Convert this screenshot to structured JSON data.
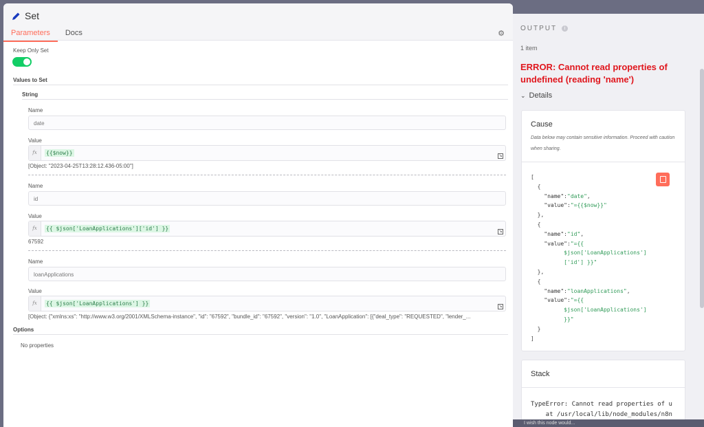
{
  "node": {
    "title": "Set",
    "tabs": [
      "Parameters",
      "Docs"
    ]
  },
  "params": {
    "keep_only_set_label": "Keep Only Set",
    "keep_only_set_value": true,
    "values_to_set_label": "Values to Set",
    "string_label": "String",
    "name_label": "Name",
    "value_label": "Value",
    "entries": [
      {
        "name": "date",
        "expr": "{{$now}}",
        "result": "[Object: \"2023-04-25T13:28:12.436-05:00\"]"
      },
      {
        "name": "id",
        "expr": "{{ $json['LoanApplications']['id'] }}",
        "result": "67592"
      },
      {
        "name": "loanApplications",
        "expr": "{{ $json['LoanApplications'] }}",
        "result": "[Object: {\"xmlns:xs\": \"http://www.w3.org/2001/XMLSchema-instance\", \"id\": \"67592\", \"bundle_id\": \"67592\", \"version\": \"1.0\", \"LoanApplication\": [{\"deal_type\": \"REQUESTED\", \"lender_..."
      }
    ],
    "options_label": "Options",
    "no_properties": "No properties"
  },
  "output": {
    "title": "OUTPUT",
    "items_count": "1 item",
    "error": "ERROR: Cannot read properties of undefined (reading 'name')",
    "details_label": "Details",
    "cause_title": "Cause",
    "cause_desc": "Data below may contain sensitive information. Proceed with caution when sharing.",
    "stack_title": "Stack",
    "stack_lines": [
      "TypeError: Cannot read properties of u",
      "    at /usr/local/lib/node_modules/n8n"
    ],
    "bottom_text": "I wish this node would..."
  },
  "colors": {
    "accent": "#ff6d5a",
    "error": "#e0161d",
    "toggle_on": "#13ce66",
    "code_green": "#2f9a57"
  }
}
